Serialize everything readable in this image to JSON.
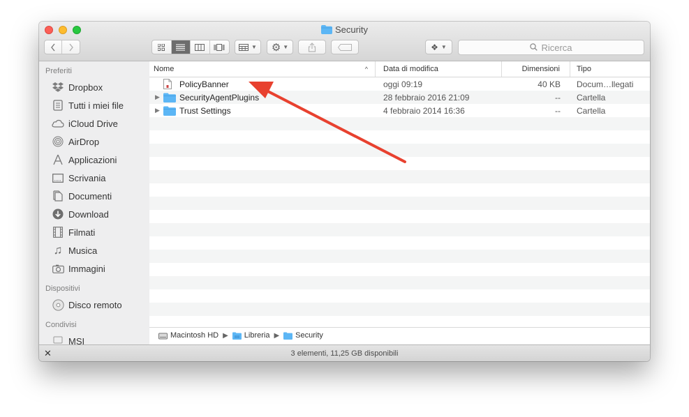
{
  "window": {
    "title": "Security"
  },
  "toolbar": {
    "search_placeholder": "Ricerca"
  },
  "sidebar": {
    "sections": [
      {
        "title": "Preferiti",
        "items": [
          {
            "label": "Dropbox",
            "icon": "dropbox-icon"
          },
          {
            "label": "Tutti i miei file",
            "icon": "all-files-icon"
          },
          {
            "label": "iCloud Drive",
            "icon": "cloud-icon"
          },
          {
            "label": "AirDrop",
            "icon": "airdrop-icon"
          },
          {
            "label": "Applicazioni",
            "icon": "applications-icon"
          },
          {
            "label": "Scrivania",
            "icon": "desktop-icon"
          },
          {
            "label": "Documenti",
            "icon": "documents-icon"
          },
          {
            "label": "Download",
            "icon": "download-icon"
          },
          {
            "label": "Filmati",
            "icon": "movies-icon"
          },
          {
            "label": "Musica",
            "icon": "music-icon"
          },
          {
            "label": "Immagini",
            "icon": "pictures-icon"
          }
        ]
      },
      {
        "title": "Dispositivi",
        "items": [
          {
            "label": "Disco remoto",
            "icon": "disc-icon"
          }
        ]
      },
      {
        "title": "Condivisi",
        "items": [
          {
            "label": "MSI",
            "icon": "network-icon"
          }
        ]
      }
    ]
  },
  "columns": {
    "name": "Nome",
    "date": "Data di modifica",
    "size": "Dimensioni",
    "kind": "Tipo"
  },
  "files": [
    {
      "name": "PolicyBanner",
      "date": "oggi 09:19",
      "size": "40 KB",
      "kind": "Docum…llegati",
      "type": "document"
    },
    {
      "name": "SecurityAgentPlugins",
      "date": "28 febbraio 2016 21:09",
      "size": "--",
      "kind": "Cartella",
      "type": "folder"
    },
    {
      "name": "Trust Settings",
      "date": "4 febbraio 2014 16:36",
      "size": "--",
      "kind": "Cartella",
      "type": "folder"
    }
  ],
  "pathbar": [
    "Macintosh HD",
    "Libreria",
    "Security"
  ],
  "status": "3 elementi, 11,25 GB disponibili",
  "colors": {
    "folder": "#5cb6f5",
    "annotation_arrow": "#e8412f"
  }
}
